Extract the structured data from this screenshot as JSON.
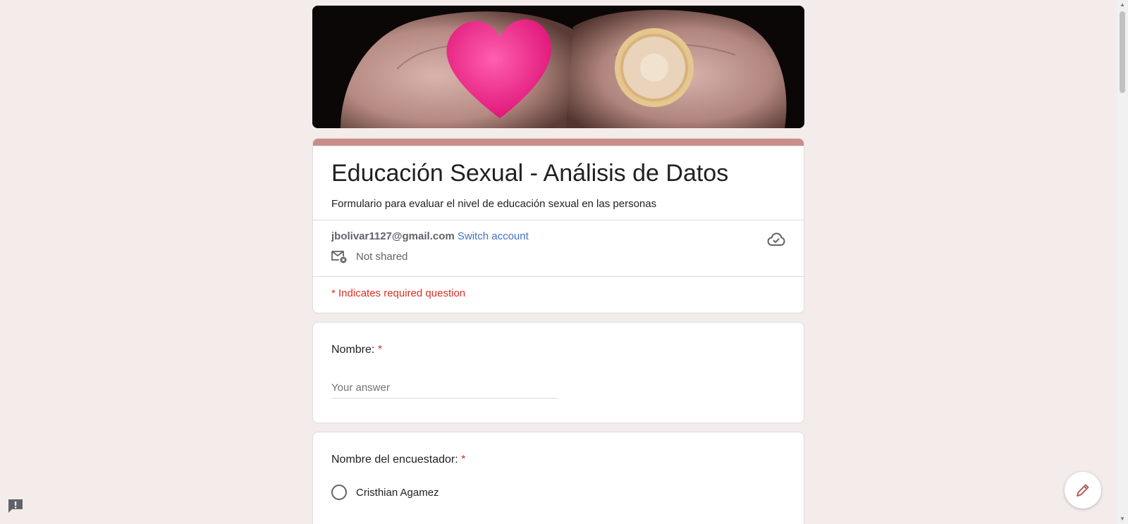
{
  "form": {
    "title": "Educación Sexual - Análisis de Datos",
    "description": "Formulario para evaluar el nivel de educación sexual en las personas"
  },
  "account": {
    "email": "jbolivar1127@gmail.com",
    "switch_label": "Switch account",
    "shared_status": "Not shared"
  },
  "required_note": "* Indicates required question",
  "questions": [
    {
      "label": "Nombre:",
      "required_mark": "*",
      "placeholder": "Your answer"
    },
    {
      "label": "Nombre del encuestador:",
      "required_mark": "*",
      "options": [
        "Cristhian Agamez"
      ]
    }
  ],
  "colors": {
    "background": "#f4eceb",
    "accent": "#c98d8a",
    "link": "#4273c6",
    "required": "#d93025"
  },
  "icons": {
    "banner": "hands-heart-condom-image",
    "shared": "mail-not-shared-icon",
    "cloud": "cloud-saved-icon",
    "fab": "pencil-edit-icon",
    "report": "report-issue-icon"
  }
}
